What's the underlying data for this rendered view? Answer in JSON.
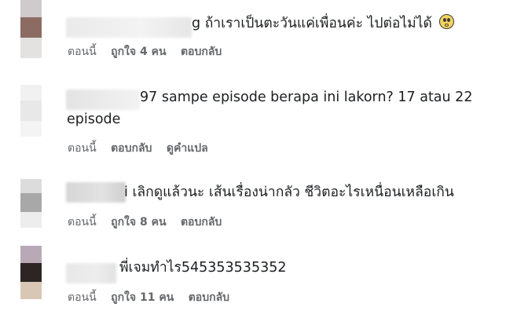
{
  "comments": [
    {
      "name_fragment": "g",
      "text": "ถ้าเราเป็นตะวันแค่เพื่อนค่ะ ไปต่อไม่ได้",
      "emoji": "thinking-face-icon",
      "time": "ตอนนี้",
      "like": "ถูกใจ 4 คน",
      "reply": "ตอบกลับ"
    },
    {
      "name_fragment": "97",
      "text_line1": "sampe episode berapa ini lakorn? 17 atau 22",
      "text_line2": "episode",
      "time": "ตอนนี้",
      "reply": "ตอบกลับ",
      "translate": "ดูคำแปล"
    },
    {
      "name_fragment": "i",
      "text": "เลิกดูแล้วนะ เส้นเรื่องน่ากลัว ชีวิตอะไรเหนื่อนเหลือเกิน",
      "time": "ตอนนี้",
      "like": "ถูกใจ 8 คน",
      "reply": "ตอบกลับ"
    },
    {
      "text": "พี่เจมทำไร545353535352",
      "time": "ตอนนี้",
      "like": "ถูกใจ 11 คน",
      "reply": "ตอบกลับ"
    }
  ]
}
